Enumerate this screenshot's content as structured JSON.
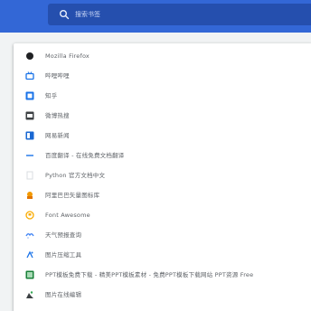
{
  "search": {
    "placeholder": "搜索书签"
  },
  "bookmarks": [
    {
      "label": "Mozilla Firefox",
      "icon": "dark-circle-icon"
    },
    {
      "label": "哔哩哔哩",
      "icon": "tv-icon"
    },
    {
      "label": "知乎",
      "icon": "zhihu-icon"
    },
    {
      "label": "微博热搜",
      "icon": "weibo-icon"
    },
    {
      "label": "网易新闻",
      "icon": "news-icon"
    },
    {
      "label": "百度翻译 - 在线免费文档翻译",
      "icon": "translate-icon"
    },
    {
      "label": "Python 官方文档中文",
      "icon": "document-icon"
    },
    {
      "label": "阿里巴巴矢量图标库",
      "icon": "iconfont-icon"
    },
    {
      "label": "Font Awesome",
      "icon": "flag-icon"
    },
    {
      "label": "天气预报查询",
      "icon": "weather-icon"
    },
    {
      "label": "图片压缩工具",
      "icon": "compress-icon"
    },
    {
      "label": "PPT模板免费下载 - 精美PPT模板素材 - 免费PPT模板下载网站 PPT资源 Free",
      "icon": "ppt-icon"
    },
    {
      "label": "图片在线编辑",
      "icon": "image-edit-icon"
    }
  ],
  "colors": {
    "header": "#3367d6",
    "search_bg": "#254fae",
    "page_bg": "#f1f3f4",
    "panel_bg": "#ffffff"
  }
}
